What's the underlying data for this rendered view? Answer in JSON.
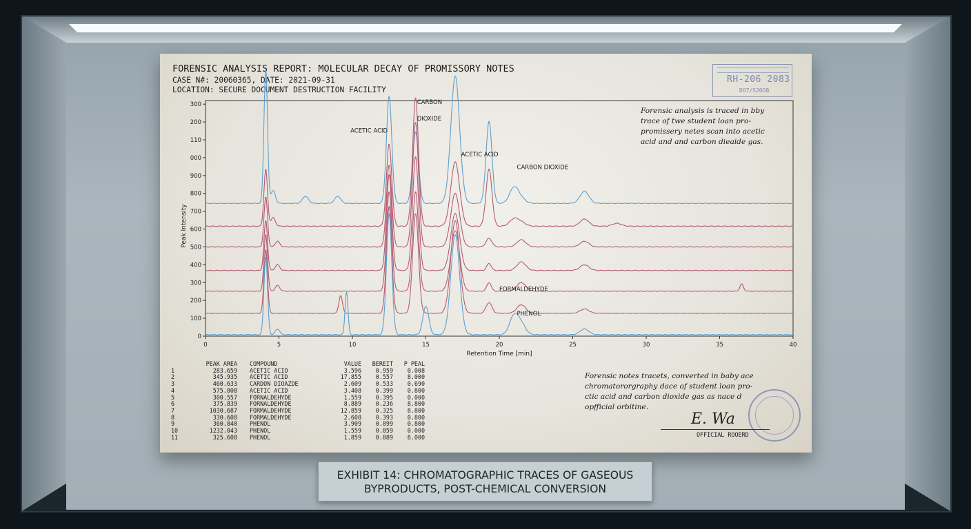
{
  "report": {
    "title": "FORENSIC ANALYSIS REPORT: MOLECULAR DECAY OF PROMISSORY NOTES",
    "case_line": "CASE N#: 20060365, DATE: 2021-09-31",
    "location_line": "LOCATION: SECURE DOCUMENT DESTRUCTION FACILITY",
    "stamp_code": "RH-206 2083",
    "stamp_sub": "DO7/S2OO8",
    "note_top": "Forensic analysis is traced in bby\ntrace of twe student loan pro-\npromissery netes scan into acetic\nacid and and carbon dieaide gas.",
    "note_bottom": "Forensic notes tracets, converted in baby ace\nchromatororgraphy dace of student loan pro-\nctic acid and carbon dioxide gas as nace d\nopfficial orbitine.",
    "signature": "E. Wa",
    "signature_label": "OFFICIAL ROOERD"
  },
  "peak_table": {
    "headers": [
      "",
      "PEAK AREA",
      "COMPOUND",
      "VALUE",
      "BEREIT",
      "P PEAL"
    ],
    "rows": [
      [
        "1",
        "283.659",
        "ACETIC ACIO",
        "3.596",
        "0.959",
        "0.008"
      ],
      [
        "2",
        "345.935",
        "ACETIC ACID",
        "17.855",
        "0.557",
        "8.000"
      ],
      [
        "3",
        "460.633",
        "CARDON DIOAZDE",
        "2.609",
        "0.533",
        "0.690"
      ],
      [
        "4",
        "575.808",
        "ACETIC ACID",
        "3.408",
        "0.399",
        "0.800"
      ],
      [
        "5",
        "300.557",
        "FORNALDEHYDE",
        "1.559",
        "0.395",
        "0.000"
      ],
      [
        "6",
        "375.839",
        "FORNALDEHYDE",
        "8.889",
        "0.236",
        "8.800"
      ],
      [
        "7",
        "1030.687",
        "FORMALDEHYDE",
        "12.859",
        "0.325",
        "8.800"
      ],
      [
        "8",
        "330.608",
        "FORMALDEHYDE",
        "2.608",
        "0.393",
        "0.800"
      ],
      [
        "9",
        "360.840",
        "PHENOL",
        "3.909",
        "0.899",
        "0.800"
      ],
      [
        "10",
        "1232.043",
        "PHENOL",
        "1.559",
        "0.859",
        "0.000"
      ],
      [
        "11",
        "325.608",
        "PHENOL",
        "1.859",
        "0.889",
        "8.000"
      ]
    ]
  },
  "plaque": {
    "line1": "EXHIBIT 14: CHROMATOGRAPHIC TRACES OF GASEOUS",
    "line2": "BYPRODUCTS, POST-CHEMICAL CONVERSION"
  },
  "colors": {
    "blue_trace": "#5f9fcf",
    "red_trace": "#b45a72",
    "paper": "#e9e8e1",
    "ink": "#1d1d1d"
  },
  "chart_data": {
    "type": "line",
    "xlabel": "Retention Time [min]",
    "ylabel": "Peak Intensity",
    "xlim": [
      0,
      40
    ],
    "ylim": [
      0,
      330
    ],
    "x_ticks": [
      "0",
      "5",
      "10",
      "15",
      "20",
      "25",
      "30",
      "35",
      "40"
    ],
    "y_ticks": [
      {
        "v": 0,
        "label": "0"
      },
      {
        "v": 25,
        "label": "100"
      },
      {
        "v": 50,
        "label": "200"
      },
      {
        "v": 75,
        "label": "300"
      },
      {
        "v": 100,
        "label": "400"
      },
      {
        "v": 125,
        "label": "500"
      },
      {
        "v": 150,
        "label": "600"
      },
      {
        "v": 175,
        "label": "700"
      },
      {
        "v": 200,
        "label": "800"
      },
      {
        "v": 225,
        "label": "900"
      },
      {
        "v": 250,
        "label": "000"
      },
      {
        "v": 275,
        "label": "110"
      },
      {
        "v": 300,
        "label": "200"
      },
      {
        "v": 325,
        "label": "300"
      }
    ],
    "grid": false,
    "series": [
      {
        "color": "blue",
        "baseline": 186,
        "peaks": [
          [
            4.1,
            190,
            0.12
          ],
          [
            4.6,
            18,
            0.15
          ],
          [
            6.8,
            10,
            0.2
          ],
          [
            9.0,
            10,
            0.2
          ],
          [
            12.5,
            150,
            0.18
          ],
          [
            14.3,
            100,
            0.2
          ],
          [
            17.0,
            178,
            0.3
          ],
          [
            21.5,
            6,
            0.3
          ],
          [
            19.3,
            115,
            0.2
          ],
          [
            21.0,
            22,
            0.3
          ],
          [
            25.8,
            17,
            0.3
          ]
        ]
      },
      {
        "color": "red",
        "baseline": 154,
        "peaks": [
          [
            4.1,
            80,
            0.12
          ],
          [
            4.6,
            12,
            0.15
          ],
          [
            12.5,
            115,
            0.18
          ],
          [
            14.3,
            180,
            0.2
          ],
          [
            17.0,
            90,
            0.3
          ],
          [
            21.5,
            5,
            0.3
          ],
          [
            19.3,
            80,
            0.2
          ],
          [
            21.0,
            10,
            0.3
          ],
          [
            25.8,
            10,
            0.3
          ],
          [
            28,
            4,
            0.3
          ]
        ]
      },
      {
        "color": "red",
        "baseline": 125,
        "peaks": [
          [
            4.1,
            70,
            0.12
          ],
          [
            4.9,
            8,
            0.15
          ],
          [
            12.5,
            115,
            0.18
          ],
          [
            14.3,
            175,
            0.2
          ],
          [
            17.0,
            75,
            0.3
          ],
          [
            21.5,
            10,
            0.3
          ],
          [
            19.3,
            12,
            0.2
          ],
          [
            25.8,
            8,
            0.3
          ]
        ]
      },
      {
        "color": "red",
        "baseline": 92,
        "peaks": [
          [
            4.1,
            70,
            0.12
          ],
          [
            4.9,
            8,
            0.15
          ],
          [
            12.5,
            135,
            0.18
          ],
          [
            14.3,
            160,
            0.2
          ],
          [
            17.0,
            80,
            0.3
          ],
          [
            21.5,
            12,
            0.3
          ],
          [
            19.3,
            10,
            0.15
          ],
          [
            25.8,
            8,
            0.3
          ]
        ]
      },
      {
        "color": "red",
        "baseline": 63,
        "peaks": [
          [
            4.1,
            80,
            0.12
          ],
          [
            4.9,
            8,
            0.15
          ],
          [
            12.5,
            140,
            0.18
          ],
          [
            14.3,
            140,
            0.2
          ],
          [
            17.0,
            85,
            0.3
          ],
          [
            21.5,
            12,
            0.3
          ],
          [
            19.3,
            12,
            0.15
          ],
          [
            36.5,
            10,
            0.12
          ]
        ]
      },
      {
        "color": "red",
        "baseline": 32,
        "peaks": [
          [
            4.1,
            90,
            0.12
          ],
          [
            9.2,
            25,
            0.12
          ],
          [
            12.5,
            150,
            0.18
          ],
          [
            14.3,
            140,
            0.2
          ],
          [
            17.0,
            130,
            0.3
          ],
          [
            21.5,
            12,
            0.3
          ],
          [
            19.3,
            15,
            0.2
          ],
          [
            25.8,
            6,
            0.3
          ]
        ]
      },
      {
        "color": "blue",
        "baseline": 2,
        "peaks": [
          [
            4.1,
            110,
            0.12
          ],
          [
            4.9,
            8,
            0.15
          ],
          [
            9.6,
            60,
            0.1
          ],
          [
            12.5,
            170,
            0.18
          ],
          [
            15.0,
            40,
            0.2
          ],
          [
            17.0,
            140,
            0.3
          ],
          [
            21.5,
            14,
            0.3
          ],
          [
            21.0,
            26,
            0.3
          ],
          [
            25.8,
            8,
            0.3
          ]
        ]
      }
    ],
    "annotations": [
      {
        "text": "ACETIC ACID",
        "x": 12.4,
        "y": 285
      },
      {
        "text": "CARBON",
        "x": 14.4,
        "y": 325
      },
      {
        "text": "DIOXIDE",
        "x": 14.4,
        "y": 302
      },
      {
        "text": "ACETIC ACID",
        "x": 17.4,
        "y": 252
      },
      {
        "text": "CARBON DIOXIDE",
        "x": 21.2,
        "y": 234
      },
      {
        "text": "FORMALDEHYDE",
        "x": 20.0,
        "y": 63
      },
      {
        "text": "PHENOL",
        "x": 21.2,
        "y": 29
      }
    ]
  }
}
